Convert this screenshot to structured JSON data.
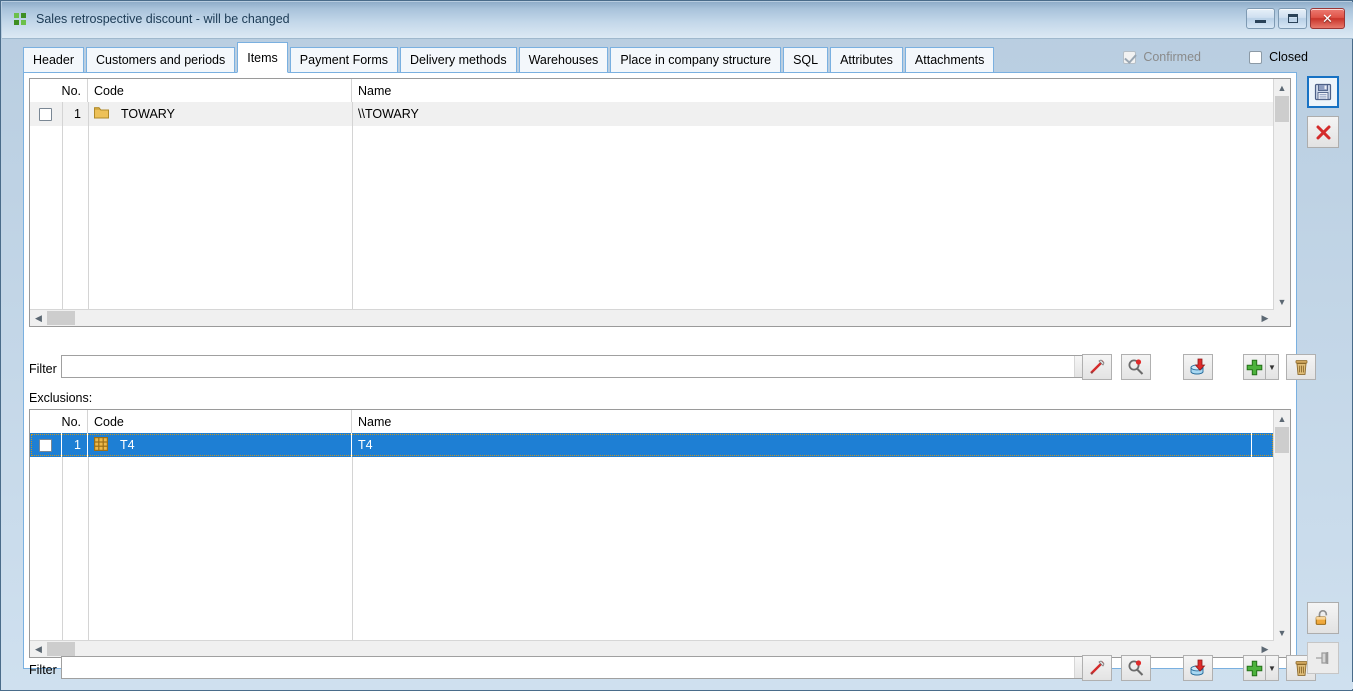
{
  "window": {
    "title": "Sales retrospective discount - will be changed",
    "app_icon": "app-icon",
    "minimize_label": "Minimize",
    "maximize_label": "Maximize",
    "close_label": "Close"
  },
  "tabs": [
    {
      "label": "Header",
      "active": false
    },
    {
      "label": "Customers and periods",
      "active": false
    },
    {
      "label": "Items",
      "active": true
    },
    {
      "label": "Payment Forms",
      "active": false
    },
    {
      "label": "Delivery methods",
      "active": false
    },
    {
      "label": "Warehouses",
      "active": false
    },
    {
      "label": "Place in company structure",
      "active": false
    },
    {
      "label": "SQL",
      "active": false
    },
    {
      "label": "Attributes",
      "active": false
    },
    {
      "label": "Attachments",
      "active": false
    }
  ],
  "flags": {
    "confirmed_label": "Confirmed",
    "confirmed_checked": true,
    "confirmed_disabled": true,
    "closed_label": "Closed",
    "closed_checked": false
  },
  "items_grid": {
    "columns": [
      "No.",
      "Code",
      "Name"
    ],
    "rows": [
      {
        "checked": false,
        "no": "1",
        "icon": "folder-icon",
        "code": "TOWARY",
        "name": "\\\\TOWARY",
        "selected": false
      }
    ]
  },
  "exclusions": {
    "section_label": "Exclusions:",
    "columns": [
      "No.",
      "Code",
      "Name"
    ],
    "rows": [
      {
        "checked": false,
        "no": "1",
        "icon": "table-icon",
        "code": "T4",
        "name": "T4",
        "selected": true
      }
    ]
  },
  "filter_top": {
    "label": "Filter",
    "value": "",
    "placeholder": "",
    "dropdown_icon": "chevron-down-icon",
    "buttons": [
      {
        "name": "edit-filter-button",
        "icon": "pen-icon"
      },
      {
        "name": "search-filter-button",
        "icon": "magnifier-icon"
      },
      {
        "name": "import-from-database-button",
        "icon": "database-import-icon"
      },
      {
        "name": "add-button",
        "icon": "plus-icon"
      },
      {
        "name": "add-dropdown-button",
        "icon": "chevron-down-icon"
      },
      {
        "name": "delete-button",
        "icon": "trash-icon"
      }
    ]
  },
  "filter_bottom": {
    "label": "Filter",
    "value": "",
    "placeholder": "",
    "dropdown_icon": "chevron-down-icon",
    "buttons": [
      {
        "name": "edit-filter-button",
        "icon": "pen-icon"
      },
      {
        "name": "search-filter-button",
        "icon": "magnifier-icon"
      },
      {
        "name": "import-from-database-button",
        "icon": "database-import-icon"
      },
      {
        "name": "add-button",
        "icon": "plus-icon"
      },
      {
        "name": "add-dropdown-button",
        "icon": "chevron-down-icon"
      },
      {
        "name": "delete-button",
        "icon": "trash-icon"
      }
    ]
  },
  "rail": {
    "save": {
      "name": "save-button",
      "icon": "floppy-disk-icon",
      "focused": true
    },
    "cancel": {
      "name": "cancel-button",
      "icon": "red-x-icon"
    },
    "unlock": {
      "name": "unlock-button",
      "icon": "open-padlock-icon"
    },
    "pin": {
      "name": "pin-button",
      "icon": "pin-icon",
      "disabled": true
    }
  },
  "colors": {
    "accent": "#1e7fd4",
    "tab_border": "#7ab0e0",
    "selection": "#1e7fd4",
    "close_button": "#c8342a",
    "folder_icon": "#e8b84b",
    "plus_icon": "#3c9a34"
  }
}
